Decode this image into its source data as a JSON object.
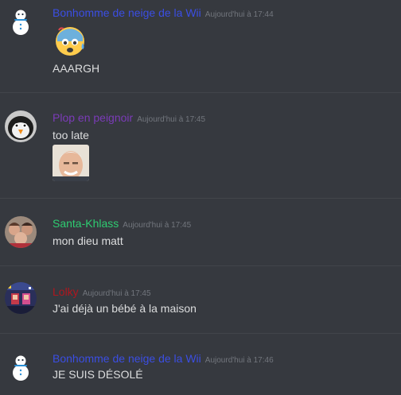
{
  "messages": [
    {
      "username": "Bonhomme de neige de la Wii",
      "timestamp": "Aujourd'hui à 17:44",
      "text": "AAARGH",
      "username_color": "#3b4ee3",
      "avatar_icon": "snowman-icon",
      "attachment_icon": "anxious-sweat-face-emoji"
    },
    {
      "username": "Plop en peignoir",
      "timestamp": "Aujourd'hui à 17:45",
      "text": "too late",
      "username_color": "#7b3bb8",
      "avatar_icon": "penguin-avatar",
      "attachment_icon": "smiling-man-meme-image"
    },
    {
      "username": "Santa-Khlass",
      "timestamp": "Aujourd'hui à 17:45",
      "text": "mon dieu matt",
      "username_color": "#2ecc71",
      "avatar_icon": "group-photo-avatar"
    },
    {
      "username": "Lolky",
      "timestamp": "Aujourd'hui à 17:45",
      "text": "J'ai déjà un bébé à la maison",
      "username_color": "#b0161e",
      "avatar_icon": "pixel-art-avatar"
    },
    {
      "username": "Bonhomme de neige de la Wii",
      "timestamp": "Aujourd'hui à 17:46",
      "text": "JE SUIS DÉSOLÉ",
      "username_color": "#3b4ee3",
      "avatar_icon": "snowman-icon"
    }
  ],
  "colors": {
    "background": "#36393f",
    "divider": "#42454a",
    "text": "#dcddde",
    "timestamp": "#72767d"
  }
}
